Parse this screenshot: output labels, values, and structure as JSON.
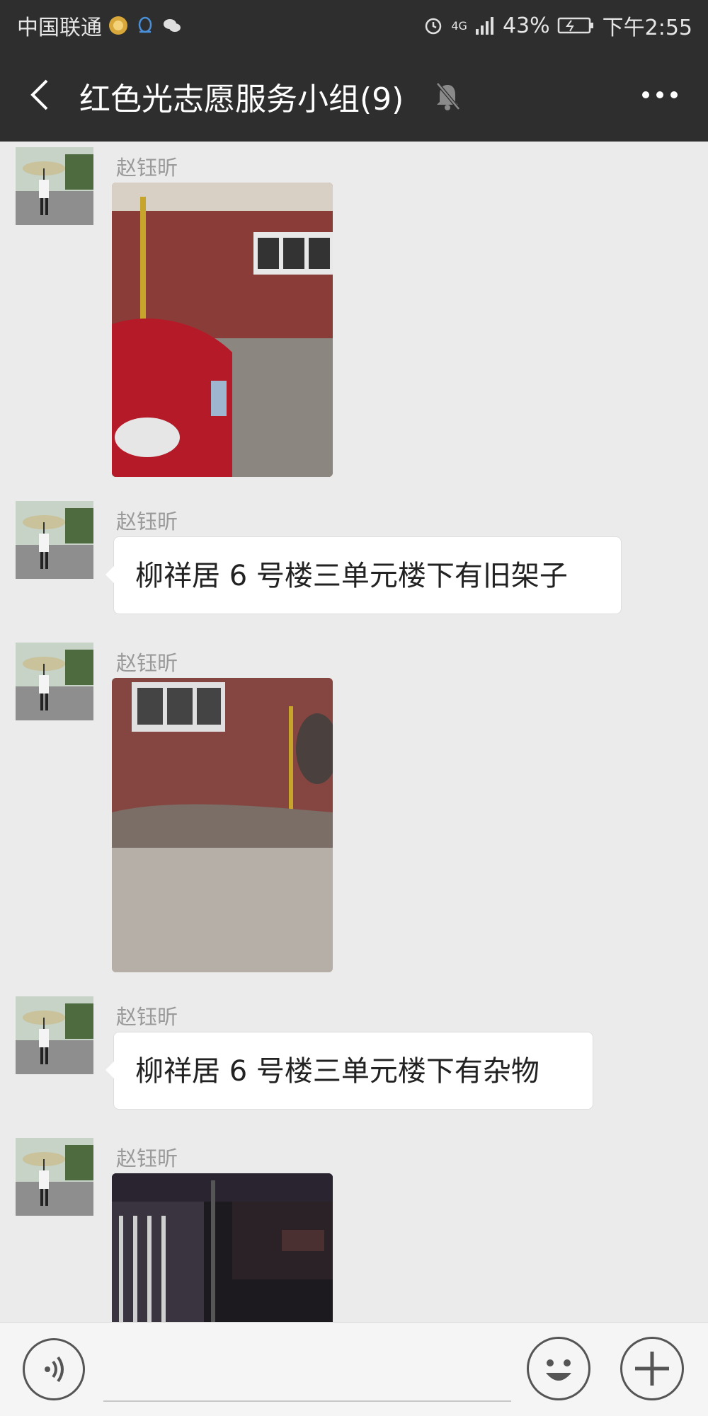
{
  "status_bar": {
    "carrier": "中国联通",
    "network": "4G",
    "battery": "43%",
    "time": "下午2:55"
  },
  "header": {
    "title": "红色光志愿服务小组(9)"
  },
  "messages": [
    {
      "sender": "赵钰昕",
      "type": "image"
    },
    {
      "sender": "赵钰昕",
      "type": "text",
      "text": "柳祥居 6 号楼三单元楼下有旧架子"
    },
    {
      "sender": "赵钰昕",
      "type": "image"
    },
    {
      "sender": "赵钰昕",
      "type": "text",
      "text": "柳祥居 6 号楼三单元楼下有杂物"
    },
    {
      "sender": "赵钰昕",
      "type": "image"
    }
  ],
  "icons": {
    "back": "chevron-left-icon",
    "mute": "bell-off-icon",
    "more": "more-dots-icon",
    "voice": "voice-icon",
    "emoji": "emoji-icon",
    "plus": "plus-icon"
  }
}
